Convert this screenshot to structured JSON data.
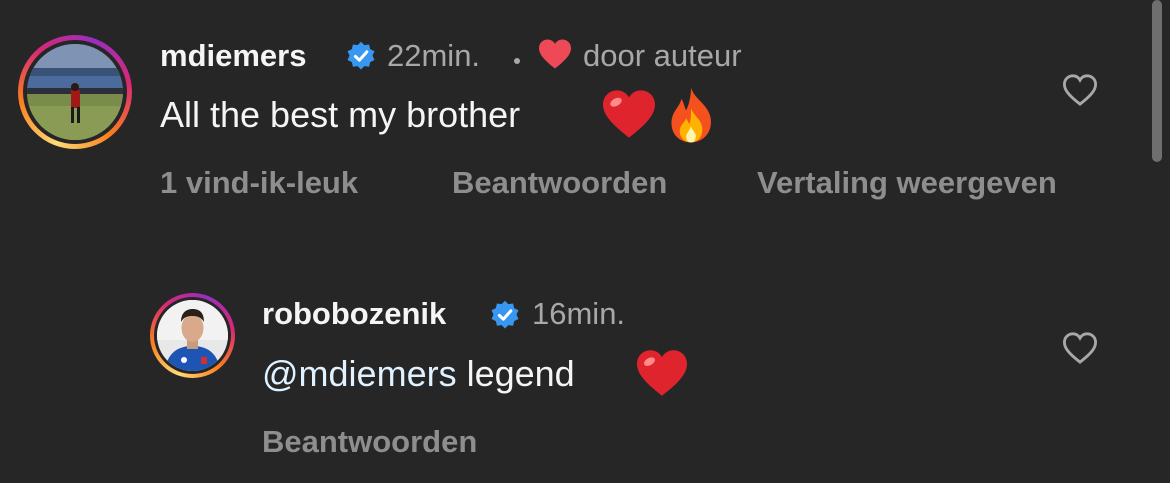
{
  "comments": [
    {
      "username": "mdiemers",
      "time": "22min.",
      "liked_by_author_text": "door auteur",
      "text": "All the best my brother",
      "likes_label": "1 vind-ik-leuk",
      "reply_label": "Beantwoorden",
      "translate_label": "Vertaling weergeven",
      "emojis": [
        "red-heart-emoji",
        "fire-emoji"
      ]
    },
    {
      "username": "robobozenik",
      "time": "16min.",
      "mention": "@mdiemers",
      "text": " legend",
      "reply_label": "Beantwoorden",
      "emojis": [
        "red-heart-emoji"
      ]
    }
  ],
  "colors": {
    "background": "#262626",
    "verified_blue": "#3897f0",
    "heart_red": "#ed4956",
    "mention": "#e0f1ff",
    "secondary_text": "#a8a8a8",
    "action_text": "#8e8e8e"
  }
}
